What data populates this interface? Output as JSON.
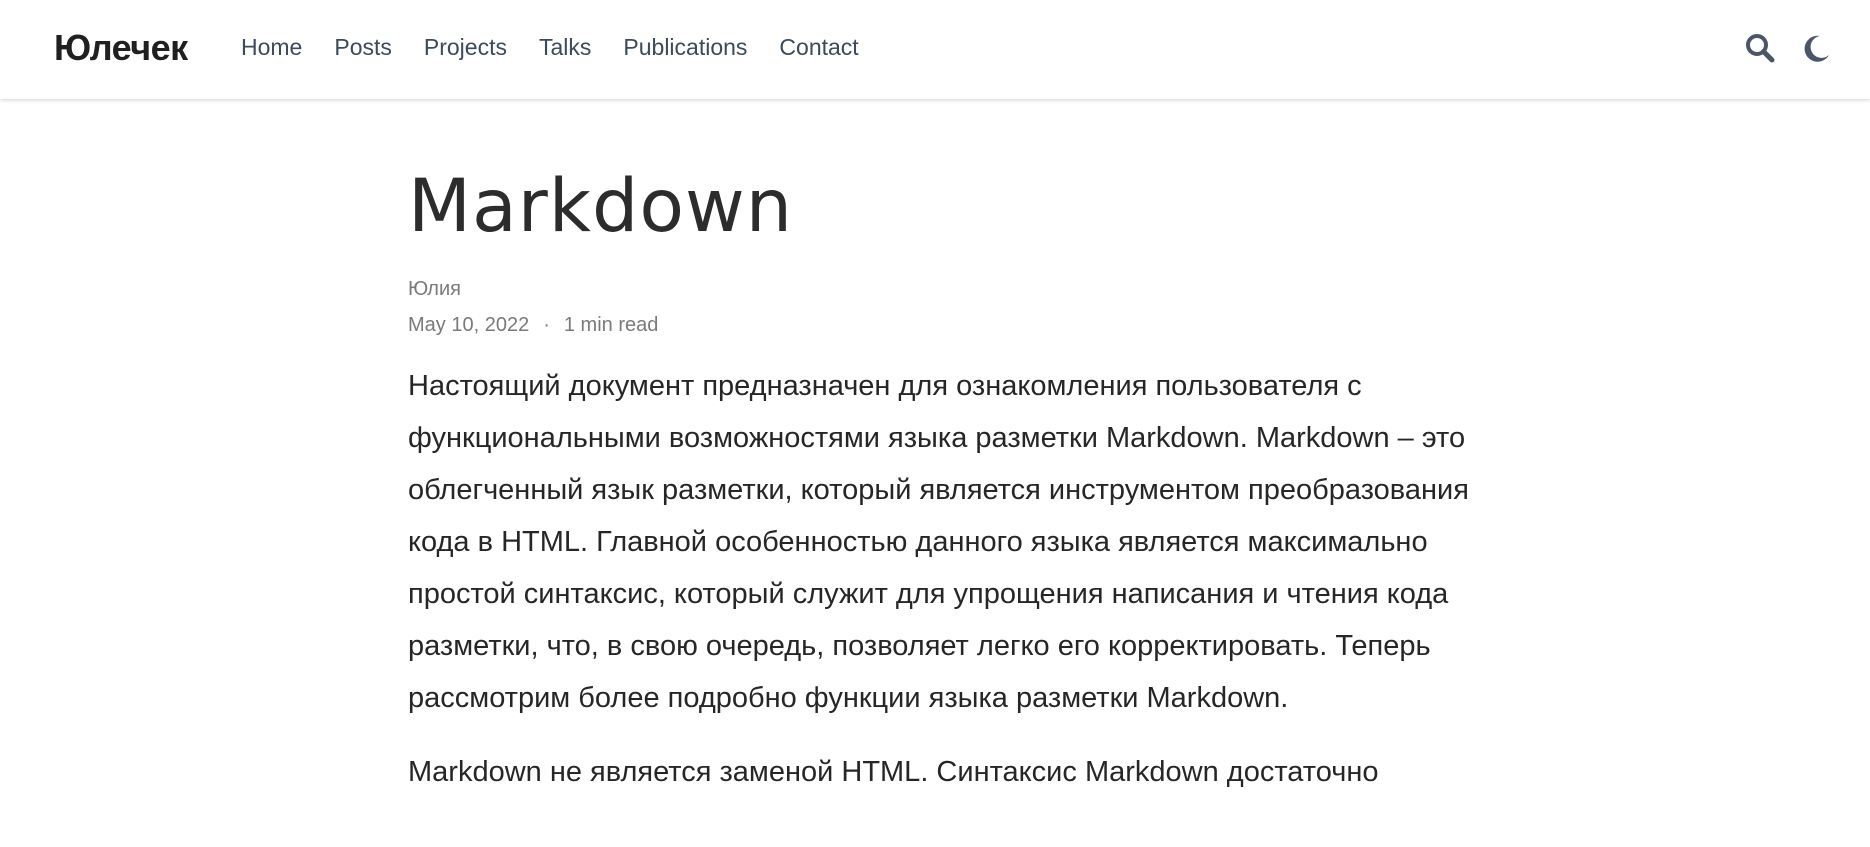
{
  "navbar": {
    "brand": "Юлечек",
    "links": [
      "Home",
      "Posts",
      "Projects",
      "Talks",
      "Publications",
      "Contact"
    ],
    "icons": {
      "search": "search-icon",
      "theme": "moon-icon"
    }
  },
  "article": {
    "title": "Markdown",
    "author": "Юлия",
    "date": "May 10, 2022",
    "separator": "·",
    "read_time": "1 min read",
    "paragraphs": [
      "Настоящий документ предназначен для ознакомления пользователя с функциональными возможностями языка разметки Markdown. Markdown – это облегченный язык разметки, который является инструментом преобразования кода в HTML. Главной особенностью данного языка является максимально простой синтаксис, который служит для упрощения написания и чтения кода разметки, что, в свою очередь, позволяет легко его корректировать. Теперь рассмотрим более подробно функции языка разметки Markdown.",
      "Markdown не является заменой HTML. Синтаксис Markdown достаточно"
    ]
  },
  "colors": {
    "nav_link": "#3b4a5c",
    "text": "#262626",
    "meta": "#7a7a7a",
    "icon": "#4a5568"
  }
}
